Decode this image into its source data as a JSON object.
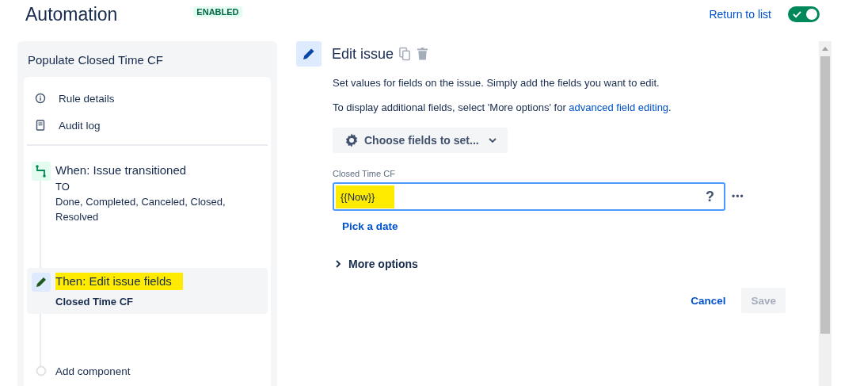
{
  "header": {
    "title": "Automation",
    "status": "ENABLED",
    "return_link": "Return to list",
    "enabled": {
      "on": true
    }
  },
  "rule": {
    "name": "Populate Closed Time CF",
    "nav": [
      {
        "kind": "info",
        "label": "Rule details"
      },
      {
        "kind": "log",
        "label": "Audit log"
      }
    ],
    "steps": [
      {
        "kind": "trigger",
        "title": "When: Issue transitioned",
        "highlighted": false,
        "selected": false,
        "lines": [
          {
            "text": "TO",
            "bold": false
          },
          {
            "text": "Done, Completed, Canceled, Closed, Resolved",
            "bold": false
          }
        ]
      },
      {
        "kind": "action",
        "title": "Then: Edit issue fields",
        "highlighted": true,
        "selected": true,
        "lines": [
          {
            "text": "Closed Time CF",
            "bold": true
          }
        ]
      },
      {
        "kind": "add",
        "title": "Add component",
        "highlighted": false,
        "selected": false
      }
    ]
  },
  "editor": {
    "title": "Edit issue",
    "description": "Set values for fields on the issue. Simply add the fields you want to edit.",
    "hint": "To display additional fields, select 'More options' for",
    "hint_link": "advanced field editing",
    "hint_end": ".",
    "choose_button": "Choose fields to set...",
    "field": {
      "label": "Closed Time CF",
      "value": "{{Now}}",
      "highlighted": true,
      "help": "?",
      "more": "•••"
    },
    "pick_date": "Pick a date",
    "more_options": "More options",
    "cancel": "Cancel",
    "save": {
      "label": "Save",
      "disabled": true
    }
  }
}
